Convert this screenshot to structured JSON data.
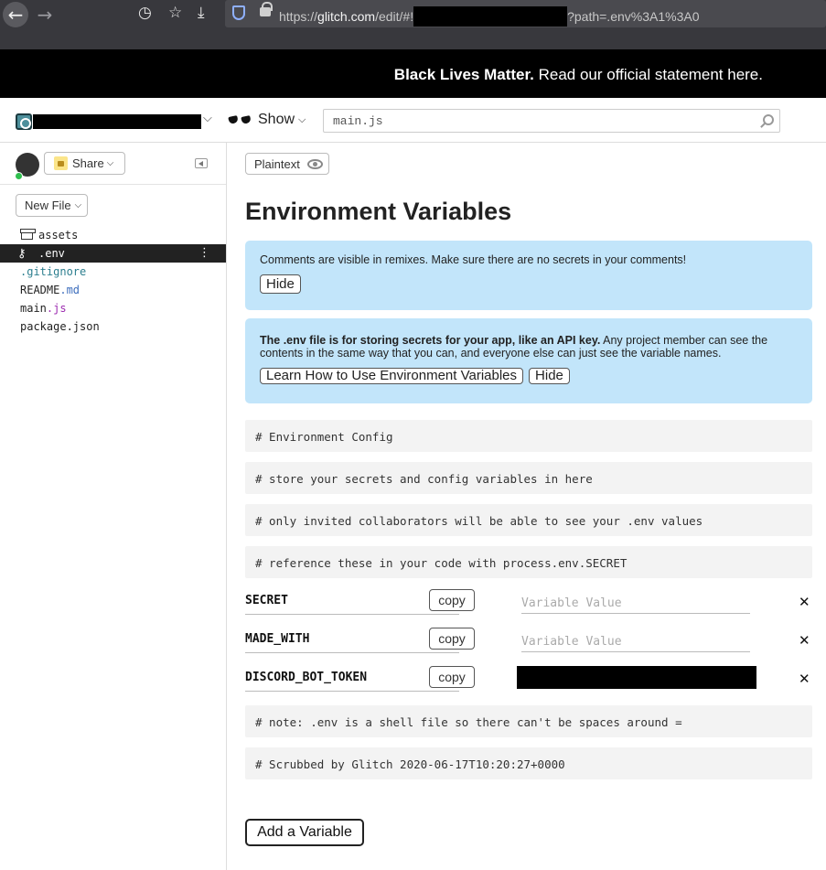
{
  "browser": {
    "url_prefix": "https://",
    "url_host": "glitch.com",
    "url_path": "/edit/#!",
    "url_suffix": "?path=.env%3A1%3A0"
  },
  "banner": {
    "bold": "Black Lives Matter.",
    "text": "Read our official statement here."
  },
  "topbar": {
    "show_label": "Show",
    "file_search_value": "main.js"
  },
  "sidebar": {
    "share_label": "Share",
    "new_file_label": "New File",
    "files": [
      {
        "name": "assets",
        "ext": ""
      },
      {
        "name": ".env",
        "ext": ""
      },
      {
        "name": ".gitignore",
        "ext": ""
      },
      {
        "name": "README",
        "ext": ".md"
      },
      {
        "name": "main",
        "ext": ".js"
      },
      {
        "name": "package.json",
        "ext": ""
      }
    ]
  },
  "editor": {
    "plaintext_label": "Plaintext",
    "title": "Environment Variables",
    "notice1": {
      "text": "Comments are visible in remixes. Make sure there are no secrets in your comments!",
      "hide_label": "Hide"
    },
    "notice2": {
      "bold": "The .env file is for storing secrets for your app, like an API key.",
      "text": " Any project member can see the contents in the same way that you can, and everyone else can just see the variable names.",
      "learn_label": "Learn How to Use Environment Variables",
      "hide_label": "Hide"
    },
    "comments_top": [
      "# Environment Config",
      "# store your secrets and config variables in here",
      "# only invited collaborators will be able to see your .env values",
      "# reference these in your code with process.env.SECRET"
    ],
    "variables": [
      {
        "key": "SECRET",
        "copy_label": "copy",
        "placeholder": "Variable Value",
        "value": ""
      },
      {
        "key": "MADE_WITH",
        "copy_label": "copy",
        "placeholder": "Variable Value",
        "value": ""
      },
      {
        "key": "DISCORD_BOT_TOKEN",
        "copy_label": "copy",
        "placeholder": "",
        "value": ""
      }
    ],
    "remove_glyph": "✕",
    "comments_bottom": [
      "# note: .env is a shell file so there can't be spaces around =",
      "# Scrubbed by Glitch 2020-06-17T10:20:27+0000"
    ],
    "add_variable_label": "Add a Variable"
  }
}
